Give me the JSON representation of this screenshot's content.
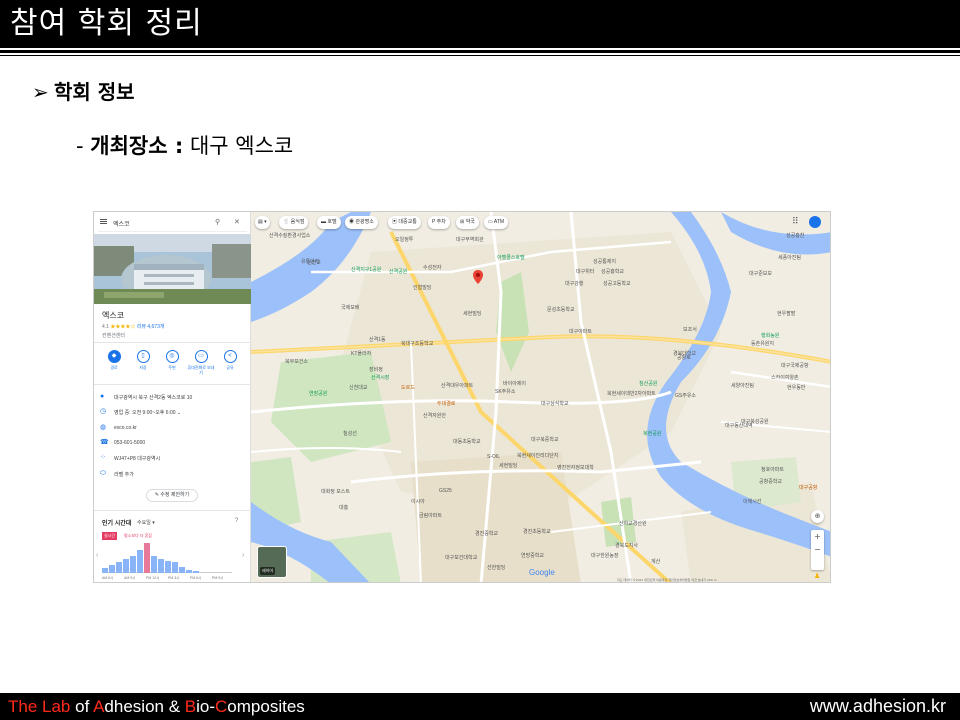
{
  "header": {
    "title": "참여 학회 정리"
  },
  "section": {
    "bullet_label": "학회 정보",
    "detail_prefix": "- ",
    "detail_key": "개최장소 :",
    "detail_value": " 대구 엑스코"
  },
  "screenshot": {
    "search": {
      "query": "엑스코"
    },
    "place": {
      "name": "엑스코",
      "rating": "4.1",
      "stars": "★★★★☆",
      "reviews": "리뷰 4,673개",
      "category": "컨벤션센터"
    },
    "actions": [
      {
        "label": "경로",
        "icon": "◆"
      },
      {
        "label": "저장",
        "icon": "▯"
      },
      {
        "label": "주변",
        "icon": "◎"
      },
      {
        "label": "휴대전화로 보내기",
        "icon": "▭"
      },
      {
        "label": "공유",
        "icon": "<"
      }
    ],
    "info": [
      {
        "icon": "location-pin-icon",
        "glyph": "●",
        "text": "대구광역시 북구 산격2동 엑스코로 10"
      },
      {
        "icon": "clock-icon",
        "glyph": "◷",
        "text": "영업 중: 오전 9:00~오후 6:00  ⌄"
      },
      {
        "icon": "globe-icon",
        "glyph": "◍",
        "text": "exco.co.kr"
      },
      {
        "icon": "phone-icon",
        "glyph": "☎",
        "text": "053-601-5000"
      },
      {
        "icon": "plus-code-icon",
        "glyph": "⁘",
        "text": "WJ47+P8 대구광역시"
      },
      {
        "icon": "label-icon",
        "glyph": "⬭",
        "text": "라벨 추가"
      }
    ],
    "suggest_edit": "✎ 수정 제안하기",
    "popular": {
      "title": "인기 시간대",
      "day": "수요일 ▾",
      "live_badge": "실시간",
      "live_text": "평소보다 더 혼잡",
      "hours": [
        "AM 6시",
        "AM 9시",
        "PM 12시",
        "PM 3시",
        "PM 6시",
        "PM 9시"
      ],
      "bar_levels": [
        0.15,
        0.25,
        0.35,
        0.45,
        0.55,
        0.75,
        1.0,
        0.55,
        0.45,
        0.4,
        0.35,
        0.2,
        0.1,
        0.08
      ]
    },
    "map": {
      "filters": [
        "음식점",
        "호텔",
        "관광명소",
        "대중교통",
        "주차",
        "약국",
        "ATM"
      ],
      "thumb_label": "레이어",
      "google": "Google",
      "attribution": "지도 데이터 ©2021  대한민국 이용약관  개인정보처리방침  의견 보내기  200 m",
      "labels": [
        {
          "t": "산격수질환경사업소",
          "c": ""
        },
        {
          "t": "오일정투",
          "c": ""
        },
        {
          "t": "대구무역회관",
          "c": ""
        },
        {
          "t": "유통단지",
          "c": ""
        },
        {
          "t": "산격지구1공원",
          "c": "g"
        },
        {
          "t": "신천교",
          "c": ""
        },
        {
          "t": "산격공원",
          "c": "g"
        },
        {
          "t": "수성전자",
          "c": ""
        },
        {
          "t": "아텔콜스호텔",
          "c": "g"
        },
        {
          "t": "성공통제지",
          "c": ""
        },
        {
          "t": "대구위터",
          "c": ""
        },
        {
          "t": "대구강행",
          "c": ""
        },
        {
          "t": "인협빌딩",
          "c": ""
        },
        {
          "t": "성공흥학교",
          "c": ""
        },
        {
          "t": "성공고등학교",
          "c": ""
        },
        {
          "t": "세풍아진팀",
          "c": ""
        },
        {
          "t": "대구준보보",
          "c": ""
        },
        {
          "t": "성공흥찬",
          "c": ""
        },
        {
          "t": "국제보배",
          "c": ""
        },
        {
          "t": "세현빌딩",
          "c": ""
        },
        {
          "t": "문성초등학교",
          "c": ""
        },
        {
          "t": "대구아파트",
          "c": ""
        },
        {
          "t": "현우팔팔",
          "c": ""
        },
        {
          "t": "북대구초등학교",
          "c": ""
        },
        {
          "t": "보조서",
          "c": ""
        },
        {
          "t": "경북대학교",
          "c": ""
        },
        {
          "t": "산격1동",
          "c": ""
        },
        {
          "t": "KT플라자",
          "c": ""
        },
        {
          "t": "장비정",
          "c": ""
        },
        {
          "t": "북부보건소",
          "c": ""
        },
        {
          "t": "산격시장",
          "c": "g"
        },
        {
          "t": "신천대교",
          "c": ""
        },
        {
          "t": "도르드",
          "c": "o"
        },
        {
          "t": "산격대우아파트",
          "c": ""
        },
        {
          "t": "SK주유소",
          "c": ""
        },
        {
          "t": "바이아제이",
          "c": ""
        },
        {
          "t": "연장공원",
          "c": "g"
        },
        {
          "t": "두대결로",
          "c": "o"
        },
        {
          "t": "대구상식학교",
          "c": ""
        },
        {
          "t": "북현세이데반2차아파트",
          "c": ""
        },
        {
          "t": "GS주유소",
          "c": ""
        },
        {
          "t": "침산공원",
          "c": "g"
        },
        {
          "t": "산격자원안",
          "c": ""
        },
        {
          "t": "칠성선",
          "c": ""
        },
        {
          "t": "대동초등학교",
          "c": ""
        },
        {
          "t": "대구북중학교",
          "c": ""
        },
        {
          "t": "북현세이진리다단지",
          "c": ""
        },
        {
          "t": "복현공원",
          "c": "g"
        },
        {
          "t": "대구동산대역",
          "c": ""
        },
        {
          "t": "대구북성공원",
          "c": ""
        },
        {
          "t": "S-OIL",
          "c": ""
        },
        {
          "t": "세현빌딩",
          "c": ""
        },
        {
          "t": "영진전자정보대학",
          "c": ""
        },
        {
          "t": "GS25",
          "c": ""
        },
        {
          "t": "대화정 포스트",
          "c": ""
        },
        {
          "t": "대흥",
          "c": ""
        },
        {
          "t": "이시아",
          "c": ""
        },
        {
          "t": "금림아파트",
          "c": ""
        },
        {
          "t": "경진초등학교",
          "c": ""
        },
        {
          "t": "경진중학교",
          "c": ""
        },
        {
          "t": "산하교경산원",
          "c": ""
        },
        {
          "t": "대구보건대학교",
          "c": ""
        },
        {
          "t": "선한빌딩",
          "c": ""
        },
        {
          "t": "연방중학교",
          "c": ""
        },
        {
          "t": "경북도지사",
          "c": ""
        },
        {
          "t": "대구국제공항",
          "c": ""
        },
        {
          "t": "스카이여양촌",
          "c": ""
        },
        {
          "t": "세양아진팀",
          "c": ""
        },
        {
          "t": "현우동반",
          "c": ""
        },
        {
          "t": "행회농원",
          "c": "g"
        },
        {
          "t": "공항로",
          "c": ""
        },
        {
          "t": "등촌유원지",
          "c": ""
        },
        {
          "t": "청호아파트",
          "c": ""
        },
        {
          "t": "공항중학교",
          "c": ""
        },
        {
          "t": "대구공항",
          "c": "o"
        },
        {
          "t": "이에시선",
          "c": ""
        },
        {
          "t": "대구한원농장",
          "c": ""
        },
        {
          "t": "계산",
          "c": ""
        }
      ]
    }
  },
  "footer": {
    "lab_parts": [
      {
        "text": "The Lab",
        "red": true
      },
      {
        "text": " of ",
        "red": false
      },
      {
        "text": "A",
        "red": true
      },
      {
        "text": "dhesion & ",
        "red": false
      },
      {
        "text": "B",
        "red": true
      },
      {
        "text": "io-",
        "red": false
      },
      {
        "text": "C",
        "red": true
      },
      {
        "text": "omposites",
        "red": false
      }
    ],
    "website": "www.adhesion.kr"
  }
}
